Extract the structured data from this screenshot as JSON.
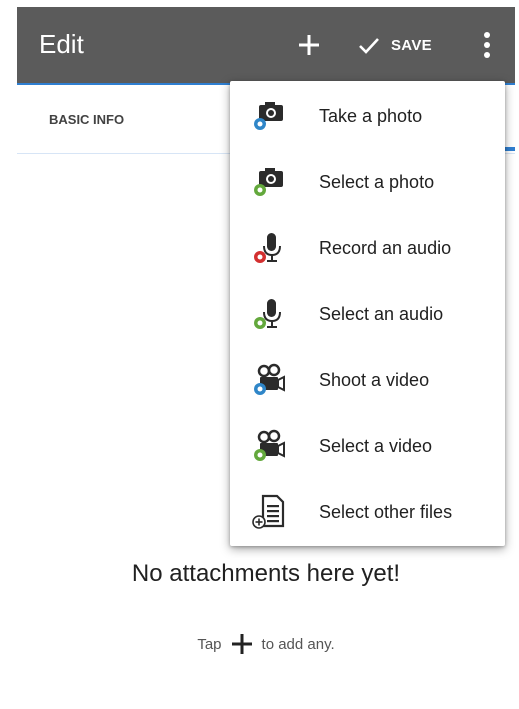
{
  "toolbar": {
    "title": "Edit",
    "save_label": "SAVE",
    "add_icon": "plus-icon",
    "save_icon": "check-icon",
    "more_icon": "more-vert-icon"
  },
  "tabs": [
    {
      "label": "BASIC INFO"
    }
  ],
  "empty_state": {
    "title": "No attachments here yet!",
    "hint_prefix": "Tap",
    "hint_suffix": "to add any."
  },
  "menu": {
    "items": [
      {
        "label": "Take a photo",
        "icon": "camera-take-icon"
      },
      {
        "label": "Select a photo",
        "icon": "camera-select-icon"
      },
      {
        "label": "Record an audio",
        "icon": "microphone-record-icon"
      },
      {
        "label": "Select an audio",
        "icon": "microphone-select-icon"
      },
      {
        "label": "Shoot a video",
        "icon": "video-camera-shoot-icon"
      },
      {
        "label": "Select a video",
        "icon": "video-camera-select-icon"
      },
      {
        "label": "Select other files",
        "icon": "file-add-icon"
      }
    ]
  },
  "colors": {
    "toolbar": "#5b5b5b",
    "accent": "#2f7fd1",
    "blue_badge": "#2f86c8",
    "green_badge": "#63a83c",
    "red_badge": "#d32f2f"
  }
}
